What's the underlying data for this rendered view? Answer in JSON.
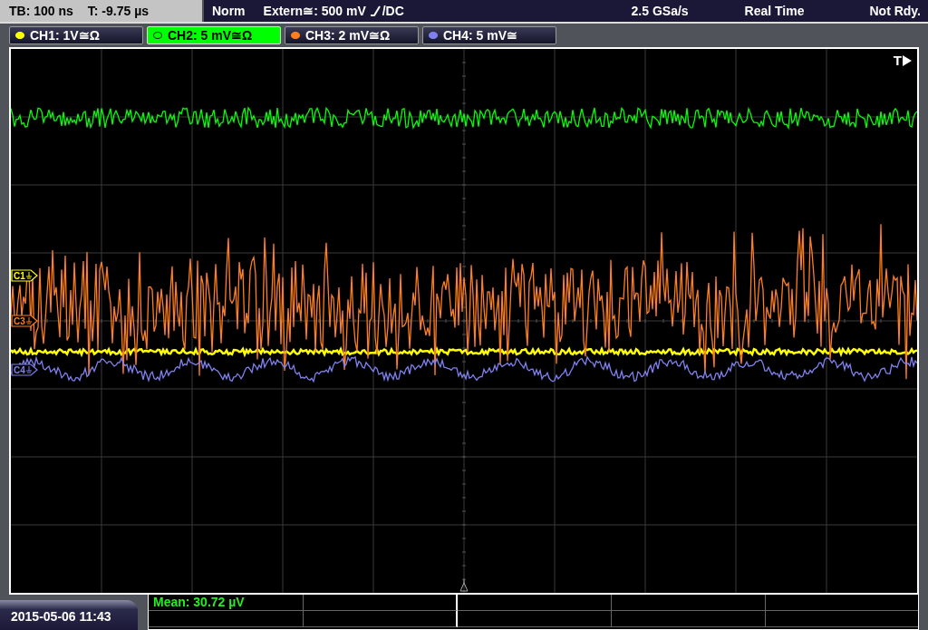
{
  "header": {
    "timebase": "TB: 100 ns",
    "trigger_time": "T: -9.75 µs",
    "trigger_mode": "Norm",
    "trigger_source": "Extern≅: 500 mV",
    "trigger_coupling": "/DC",
    "sample_rate": "2.5 GSa/s",
    "acquisition": "Real Time",
    "status": "Not Rdy."
  },
  "channels": [
    {
      "label": "CH1: 1V≅Ω",
      "color": "#ffff00",
      "selected": false,
      "marker": "C1"
    },
    {
      "label": "CH2: 5 mV≅Ω",
      "color": "#00ff00",
      "selected": true
    },
    {
      "label": "CH3: 2 mV≅Ω",
      "color": "#ff7f1e",
      "selected": false,
      "marker": "C3"
    },
    {
      "label": "CH4: 5 mV≅",
      "color": "#8080f0",
      "selected": false,
      "marker": "C4"
    }
  ],
  "trigger_label": "T",
  "measurement": "Mean: 30.72 µV",
  "datetime": "2015-05-06 11:43"
}
